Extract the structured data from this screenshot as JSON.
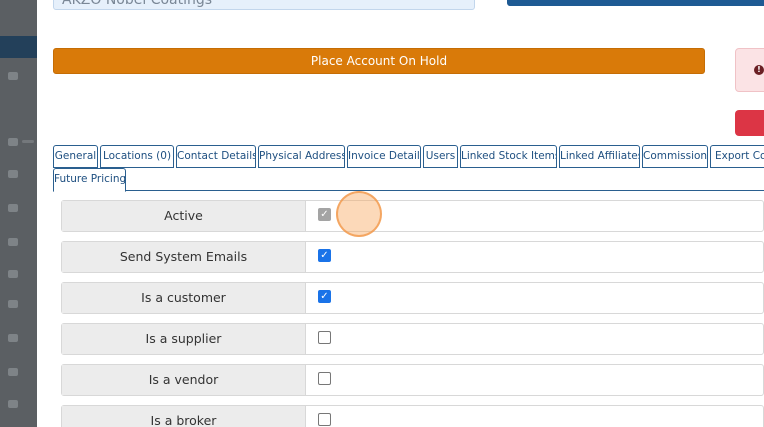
{
  "header": {
    "account_name": "AKZO Nobel Coatings",
    "place_on_hold_label": "Place Account On Hold",
    "alert_icon_glyph": "!"
  },
  "tabs": [
    {
      "label": "General"
    },
    {
      "label": "Locations (0)"
    },
    {
      "label": "Contact Details"
    },
    {
      "label": "Physical Address"
    },
    {
      "label": "Invoice Details"
    },
    {
      "label": "Users"
    },
    {
      "label": "Linked Stock Items"
    },
    {
      "label": "Linked Affiliates"
    },
    {
      "label": "Commission"
    },
    {
      "label": "Export Con"
    },
    {
      "label": "Future Pricing"
    }
  ],
  "fields": [
    {
      "label": "Active",
      "checked": true,
      "disabled": true
    },
    {
      "label": "Send System Emails",
      "checked": true,
      "disabled": false
    },
    {
      "label": "Is a customer",
      "checked": true,
      "disabled": false
    },
    {
      "label": "Is a supplier",
      "checked": false,
      "disabled": false
    },
    {
      "label": "Is a vendor",
      "checked": false,
      "disabled": false
    },
    {
      "label": "Is a broker",
      "checked": false,
      "disabled": false
    }
  ],
  "check_glyph": "✓",
  "colors": {
    "hold_button": "#d97a09",
    "tab_border": "#2a5f8f",
    "checkbox_checked": "#1a73e8",
    "danger": "#dc3545"
  }
}
